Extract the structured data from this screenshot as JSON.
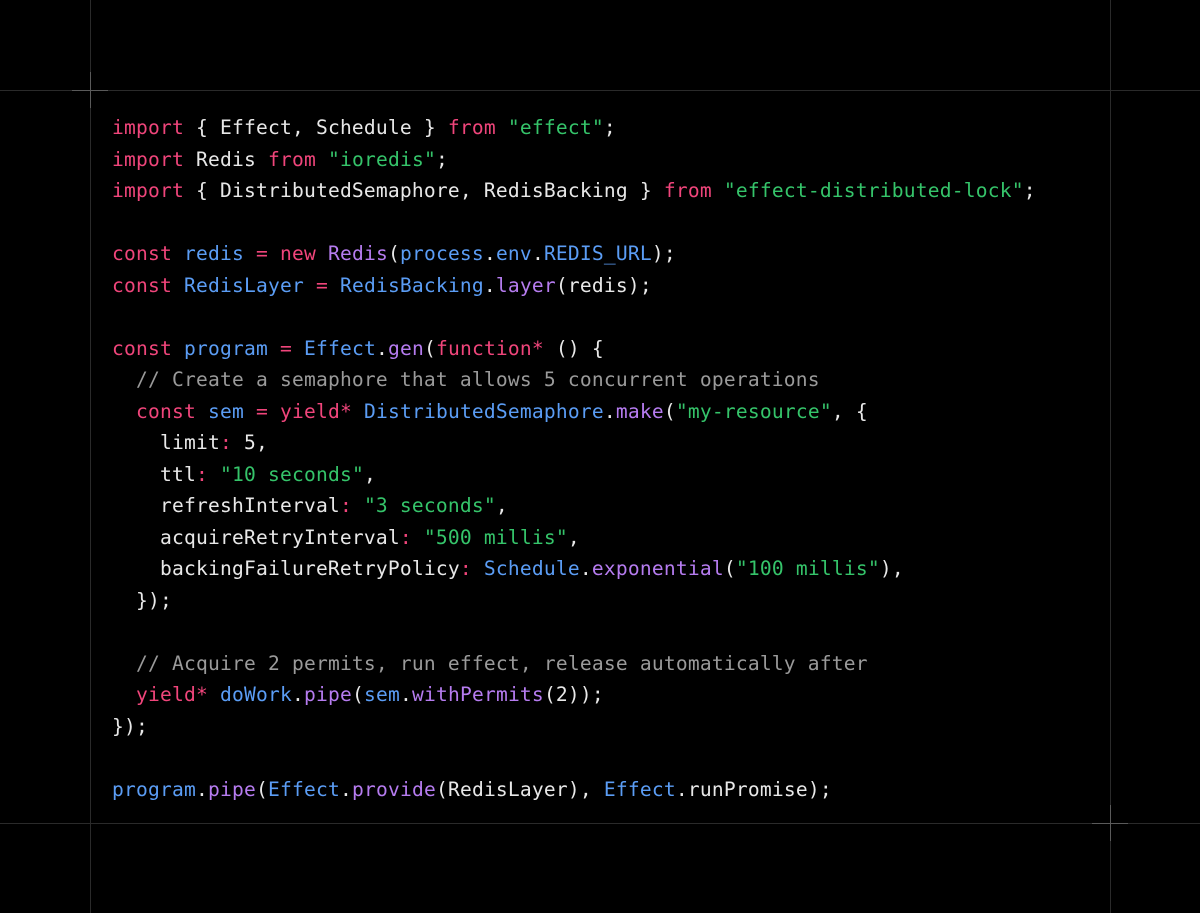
{
  "theme": {
    "background": "#000000",
    "keyword_color": "#f0457b",
    "string_color": "#35c46a",
    "identifier_color": "#5b9df5",
    "function_color": "#b67cf0",
    "comment_color": "#9a9a9a",
    "plain_color": "#e8e8e8"
  },
  "code": {
    "lines": [
      [
        [
          "kw",
          "import"
        ],
        [
          "pl",
          " { Effect, Schedule } "
        ],
        [
          "kw",
          "from"
        ],
        [
          "pl",
          " "
        ],
        [
          "str",
          "\"effect\""
        ],
        [
          "pl",
          ";"
        ]
      ],
      [
        [
          "kw",
          "import"
        ],
        [
          "pl",
          " Redis "
        ],
        [
          "kw",
          "from"
        ],
        [
          "pl",
          " "
        ],
        [
          "str",
          "\"ioredis\""
        ],
        [
          "pl",
          ";"
        ]
      ],
      [
        [
          "kw",
          "import"
        ],
        [
          "pl",
          " { DistributedSemaphore, RedisBacking } "
        ],
        [
          "kw",
          "from"
        ],
        [
          "pl",
          " "
        ],
        [
          "str",
          "\"effect-distributed-lock\""
        ],
        [
          "pl",
          ";"
        ]
      ],
      [],
      [
        [
          "kw",
          "const"
        ],
        [
          "pl",
          " "
        ],
        [
          "id",
          "redis"
        ],
        [
          "pl",
          " "
        ],
        [
          "kw",
          "="
        ],
        [
          "pl",
          " "
        ],
        [
          "kw",
          "new"
        ],
        [
          "pl",
          " "
        ],
        [
          "fn",
          "Redis"
        ],
        [
          "pl",
          "("
        ],
        [
          "id",
          "process"
        ],
        [
          "pl",
          "."
        ],
        [
          "id",
          "env"
        ],
        [
          "pl",
          "."
        ],
        [
          "id",
          "REDIS_URL"
        ],
        [
          "pl",
          ");"
        ]
      ],
      [
        [
          "kw",
          "const"
        ],
        [
          "pl",
          " "
        ],
        [
          "id",
          "RedisLayer"
        ],
        [
          "pl",
          " "
        ],
        [
          "kw",
          "="
        ],
        [
          "pl",
          " "
        ],
        [
          "id",
          "RedisBacking"
        ],
        [
          "pl",
          "."
        ],
        [
          "fn",
          "layer"
        ],
        [
          "pl",
          "(redis);"
        ]
      ],
      [],
      [
        [
          "kw",
          "const"
        ],
        [
          "pl",
          " "
        ],
        [
          "id",
          "program"
        ],
        [
          "pl",
          " "
        ],
        [
          "kw",
          "="
        ],
        [
          "pl",
          " "
        ],
        [
          "id",
          "Effect"
        ],
        [
          "pl",
          "."
        ],
        [
          "fn",
          "gen"
        ],
        [
          "pl",
          "("
        ],
        [
          "kw",
          "function*"
        ],
        [
          "pl",
          " () {"
        ]
      ],
      [
        [
          "pl",
          "  "
        ],
        [
          "cm",
          "// Create a semaphore that allows 5 concurrent operations"
        ]
      ],
      [
        [
          "pl",
          "  "
        ],
        [
          "kw",
          "const"
        ],
        [
          "pl",
          " "
        ],
        [
          "id",
          "sem"
        ],
        [
          "pl",
          " "
        ],
        [
          "kw",
          "="
        ],
        [
          "pl",
          " "
        ],
        [
          "kw",
          "yield*"
        ],
        [
          "pl",
          " "
        ],
        [
          "id",
          "DistributedSemaphore"
        ],
        [
          "pl",
          "."
        ],
        [
          "fn",
          "make"
        ],
        [
          "pl",
          "("
        ],
        [
          "str",
          "\"my-resource\""
        ],
        [
          "pl",
          ", {"
        ]
      ],
      [
        [
          "pl",
          "    limit"
        ],
        [
          "kw",
          ":"
        ],
        [
          "pl",
          " 5,"
        ]
      ],
      [
        [
          "pl",
          "    ttl"
        ],
        [
          "kw",
          ":"
        ],
        [
          "pl",
          " "
        ],
        [
          "str",
          "\"10 seconds\""
        ],
        [
          "pl",
          ","
        ]
      ],
      [
        [
          "pl",
          "    refreshInterval"
        ],
        [
          "kw",
          ":"
        ],
        [
          "pl",
          " "
        ],
        [
          "str",
          "\"3 seconds\""
        ],
        [
          "pl",
          ","
        ]
      ],
      [
        [
          "pl",
          "    acquireRetryInterval"
        ],
        [
          "kw",
          ":"
        ],
        [
          "pl",
          " "
        ],
        [
          "str",
          "\"500 millis\""
        ],
        [
          "pl",
          ","
        ]
      ],
      [
        [
          "pl",
          "    backingFailureRetryPolicy"
        ],
        [
          "kw",
          ":"
        ],
        [
          "pl",
          " "
        ],
        [
          "id",
          "Schedule"
        ],
        [
          "pl",
          "."
        ],
        [
          "fn",
          "exponential"
        ],
        [
          "pl",
          "("
        ],
        [
          "str",
          "\"100 millis\""
        ],
        [
          "pl",
          "),"
        ]
      ],
      [
        [
          "pl",
          "  });"
        ]
      ],
      [],
      [
        [
          "pl",
          "  "
        ],
        [
          "cm",
          "// Acquire 2 permits, run effect, release automatically after"
        ]
      ],
      [
        [
          "pl",
          "  "
        ],
        [
          "kw",
          "yield*"
        ],
        [
          "pl",
          " "
        ],
        [
          "id",
          "doWork"
        ],
        [
          "pl",
          "."
        ],
        [
          "fn",
          "pipe"
        ],
        [
          "pl",
          "("
        ],
        [
          "id",
          "sem"
        ],
        [
          "pl",
          "."
        ],
        [
          "fn",
          "withPermits"
        ],
        [
          "pl",
          "(2));"
        ]
      ],
      [
        [
          "pl",
          "});"
        ]
      ],
      [],
      [
        [
          "id",
          "program"
        ],
        [
          "pl",
          "."
        ],
        [
          "fn",
          "pipe"
        ],
        [
          "pl",
          "("
        ],
        [
          "id",
          "Effect"
        ],
        [
          "pl",
          "."
        ],
        [
          "fn",
          "provide"
        ],
        [
          "pl",
          "(RedisLayer), "
        ],
        [
          "id",
          "Effect"
        ],
        [
          "pl",
          "."
        ],
        [
          "pl",
          "runPromise);"
        ]
      ]
    ]
  }
}
